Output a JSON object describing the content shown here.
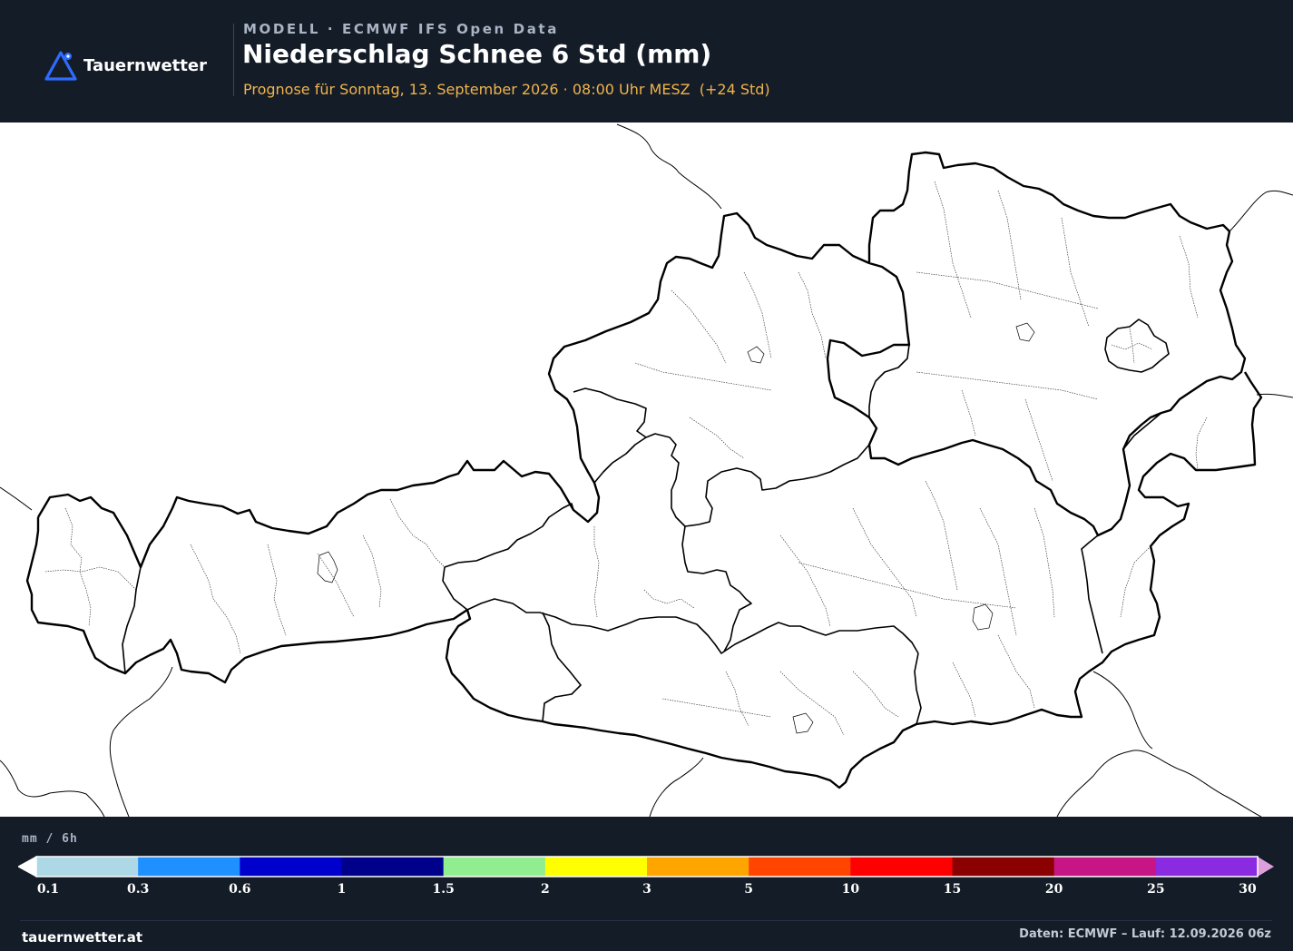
{
  "brand": {
    "name": "Tauernwetter",
    "accent": "#2f6bff"
  },
  "header": {
    "model_line": "MODELL · ECMWF IFS Open Data",
    "title": "Niederschlag Schnee 6 Std (mm)",
    "subtitle": "Prognose für Sonntag, 13. September 2026 · 08:00 Uhr MESZ  (+24 Std)"
  },
  "map": {
    "region": "Austria",
    "background_color": "#ffffff",
    "border_color": "#000000",
    "precipitation_shown": "none"
  },
  "legend": {
    "unit": "mm / 6h",
    "colors": [
      "#add8e6",
      "#1e90ff",
      "#0000cd",
      "#00008b",
      "#90ee90",
      "#ffff00",
      "#ffa500",
      "#ff4500",
      "#ff0000",
      "#8b0000",
      "#c71585",
      "#8a2be2"
    ],
    "under_color": "#ffffff",
    "over_color": "#dda0dd",
    "ticks": [
      "0.1",
      "0.3",
      "0.6",
      "1",
      "1.5",
      "2",
      "3",
      "5",
      "10",
      "15",
      "20",
      "25",
      "30"
    ]
  },
  "footer": {
    "site": "tauernwetter.at",
    "credit": "Daten: ECMWF – Lauf: 12.09.2026 06z"
  }
}
